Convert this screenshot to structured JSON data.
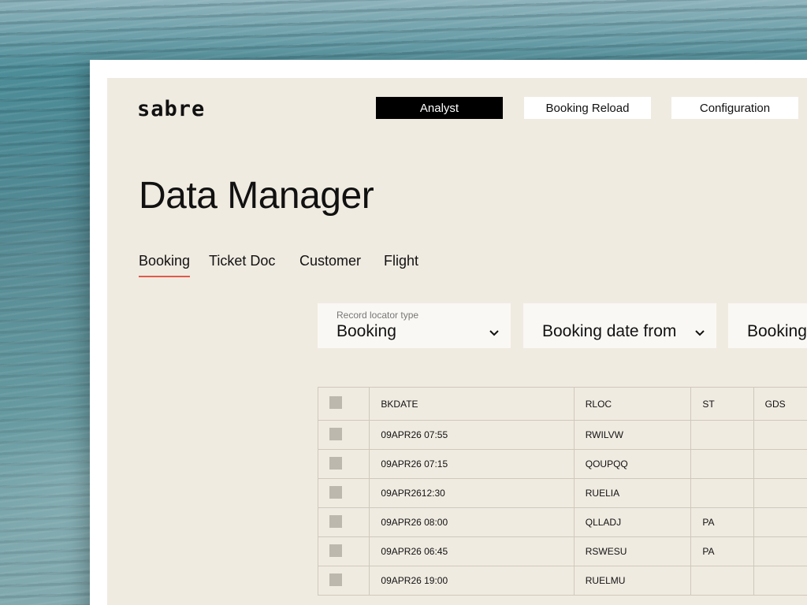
{
  "logo": "sabre",
  "nav": {
    "analyst": "Analyst",
    "booking_reload": "Booking Reload",
    "configuration": "Configuration"
  },
  "page_title": "Data Manager",
  "tabs": [
    "Booking",
    "Ticket Doc",
    "Customer",
    "Flight"
  ],
  "active_tab": "Booking",
  "filters": {
    "record_locator": {
      "label": "Record locator type",
      "value": "Booking"
    },
    "booking_date_from": {
      "value": "Booking date from"
    },
    "booking_date_to": {
      "value": "Booking"
    }
  },
  "table": {
    "columns": [
      "BKDATE",
      "RLOC",
      "ST",
      "GDS"
    ],
    "rows": [
      [
        "09APR26 07:55",
        "RWILVW",
        "",
        ""
      ],
      [
        "09APR26 07:15",
        "QOUPQQ",
        "",
        ""
      ],
      [
        "09APR2612:30",
        "RUELIA",
        "",
        ""
      ],
      [
        "09APR26 08:00",
        "QLLADJ",
        "PA",
        ""
      ],
      [
        "09APR26 06:45",
        "RSWESU",
        "PA",
        ""
      ],
      [
        "09APR26 19:00",
        "RUELMU",
        "",
        ""
      ]
    ]
  },
  "colors": {
    "accent": "#e05a4a",
    "panel": "#f0ebe1",
    "active_nav": "#000000"
  },
  "icons": {
    "dropdown": "chevron-down-icon",
    "row_select": "checkbox-icon"
  }
}
